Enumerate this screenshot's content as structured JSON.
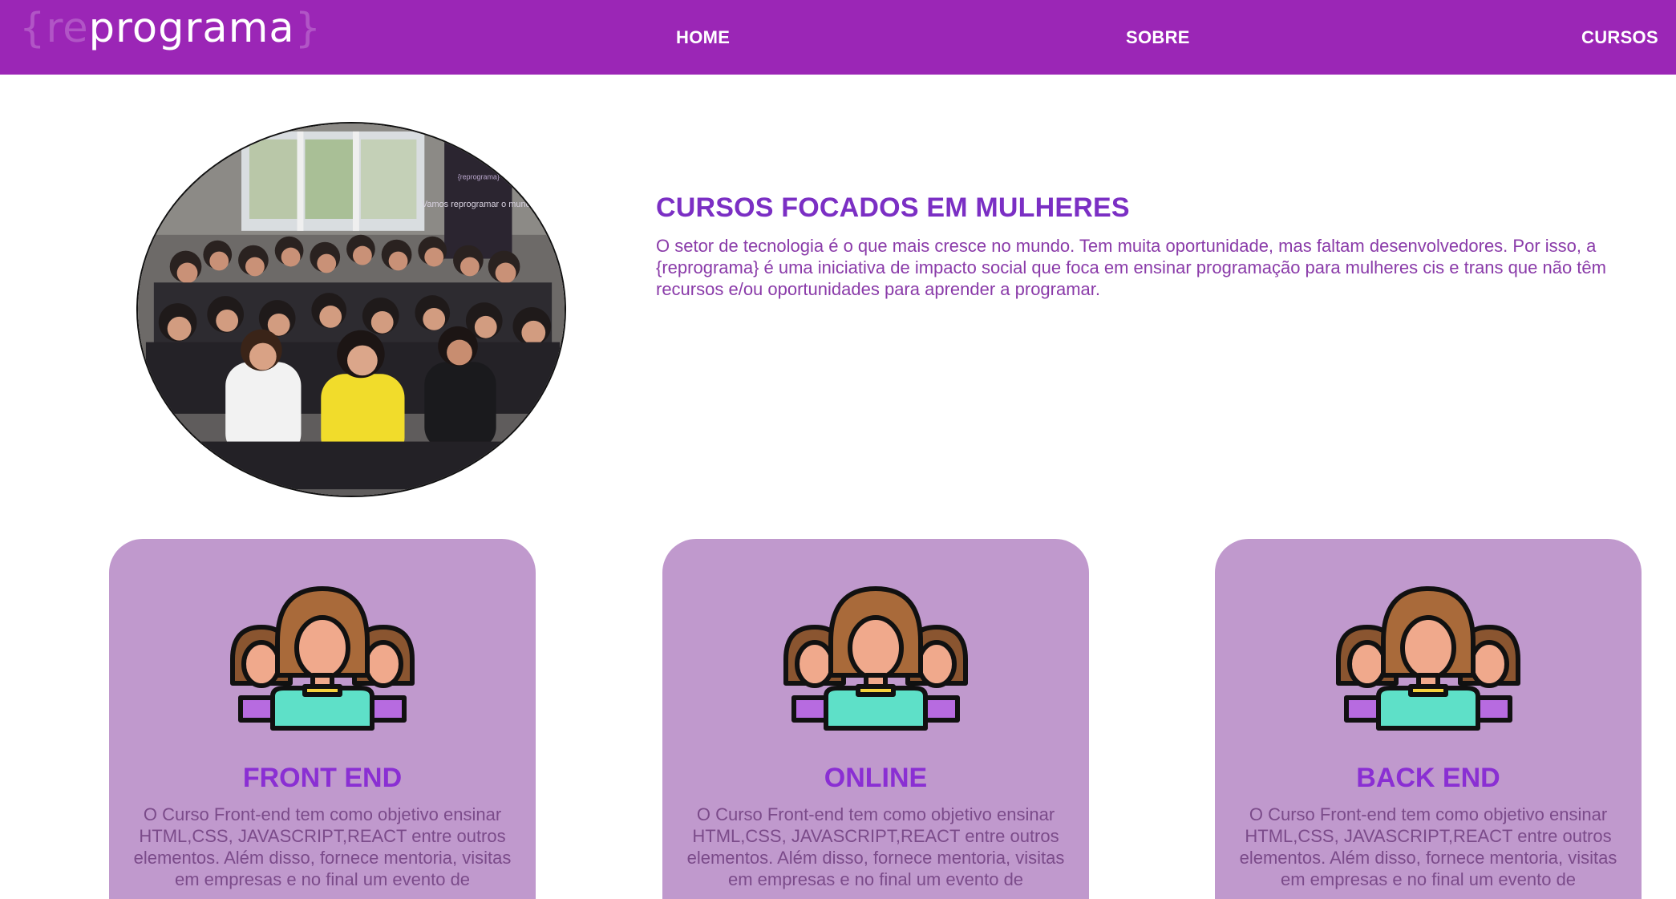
{
  "header": {
    "logo": {
      "prefix": "{re",
      "main": "programa",
      "suffix": "}"
    },
    "nav": [
      {
        "label": "HOME"
      },
      {
        "label": "SOBRE"
      },
      {
        "label": "CURSOS"
      }
    ]
  },
  "hero": {
    "title": "CURSOS FOCADOS EM MULHERES",
    "text": "O setor de tecnologia é o que mais cresce no mundo. Tem muita oportunidade, mas faltam desenvolvedores. Por isso, a {reprograma} é uma iniciativa de impacto social que foca em ensinar programação para mulheres cis e trans que não têm recursos e/ou oportunidades para aprender a programar.",
    "photo_banner_text": "Vamos reprogramar o mundo",
    "photo_banner_brand": "{reprograma}"
  },
  "courses": [
    {
      "icon": "women-group-icon",
      "title": "FRONT END",
      "text": "O Curso Front-end tem como objetivo ensinar HTML,CSS, JAVASCRIPT,REACT entre outros elementos. Além disso, fornece mentoria, visitas em empresas e no final um evento de"
    },
    {
      "icon": "women-group-icon",
      "title": "ONLINE",
      "text": "O Curso Front-end tem como objetivo ensinar HTML,CSS, JAVASCRIPT,REACT entre outros elementos. Além disso, fornece mentoria, visitas em empresas e no final um evento de"
    },
    {
      "icon": "women-group-icon",
      "title": "BACK END",
      "text": "O Curso Front-end tem como objetivo ensinar HTML,CSS, JAVASCRIPT,REACT entre outros elementos. Além disso, fornece mentoria, visitas em empresas e no final um evento de"
    }
  ],
  "colors": {
    "header_bg": "#9b26b6",
    "card_bg": "#c099cd",
    "title_purple": "#7b2fc4",
    "card_title": "#8a2fd3"
  }
}
